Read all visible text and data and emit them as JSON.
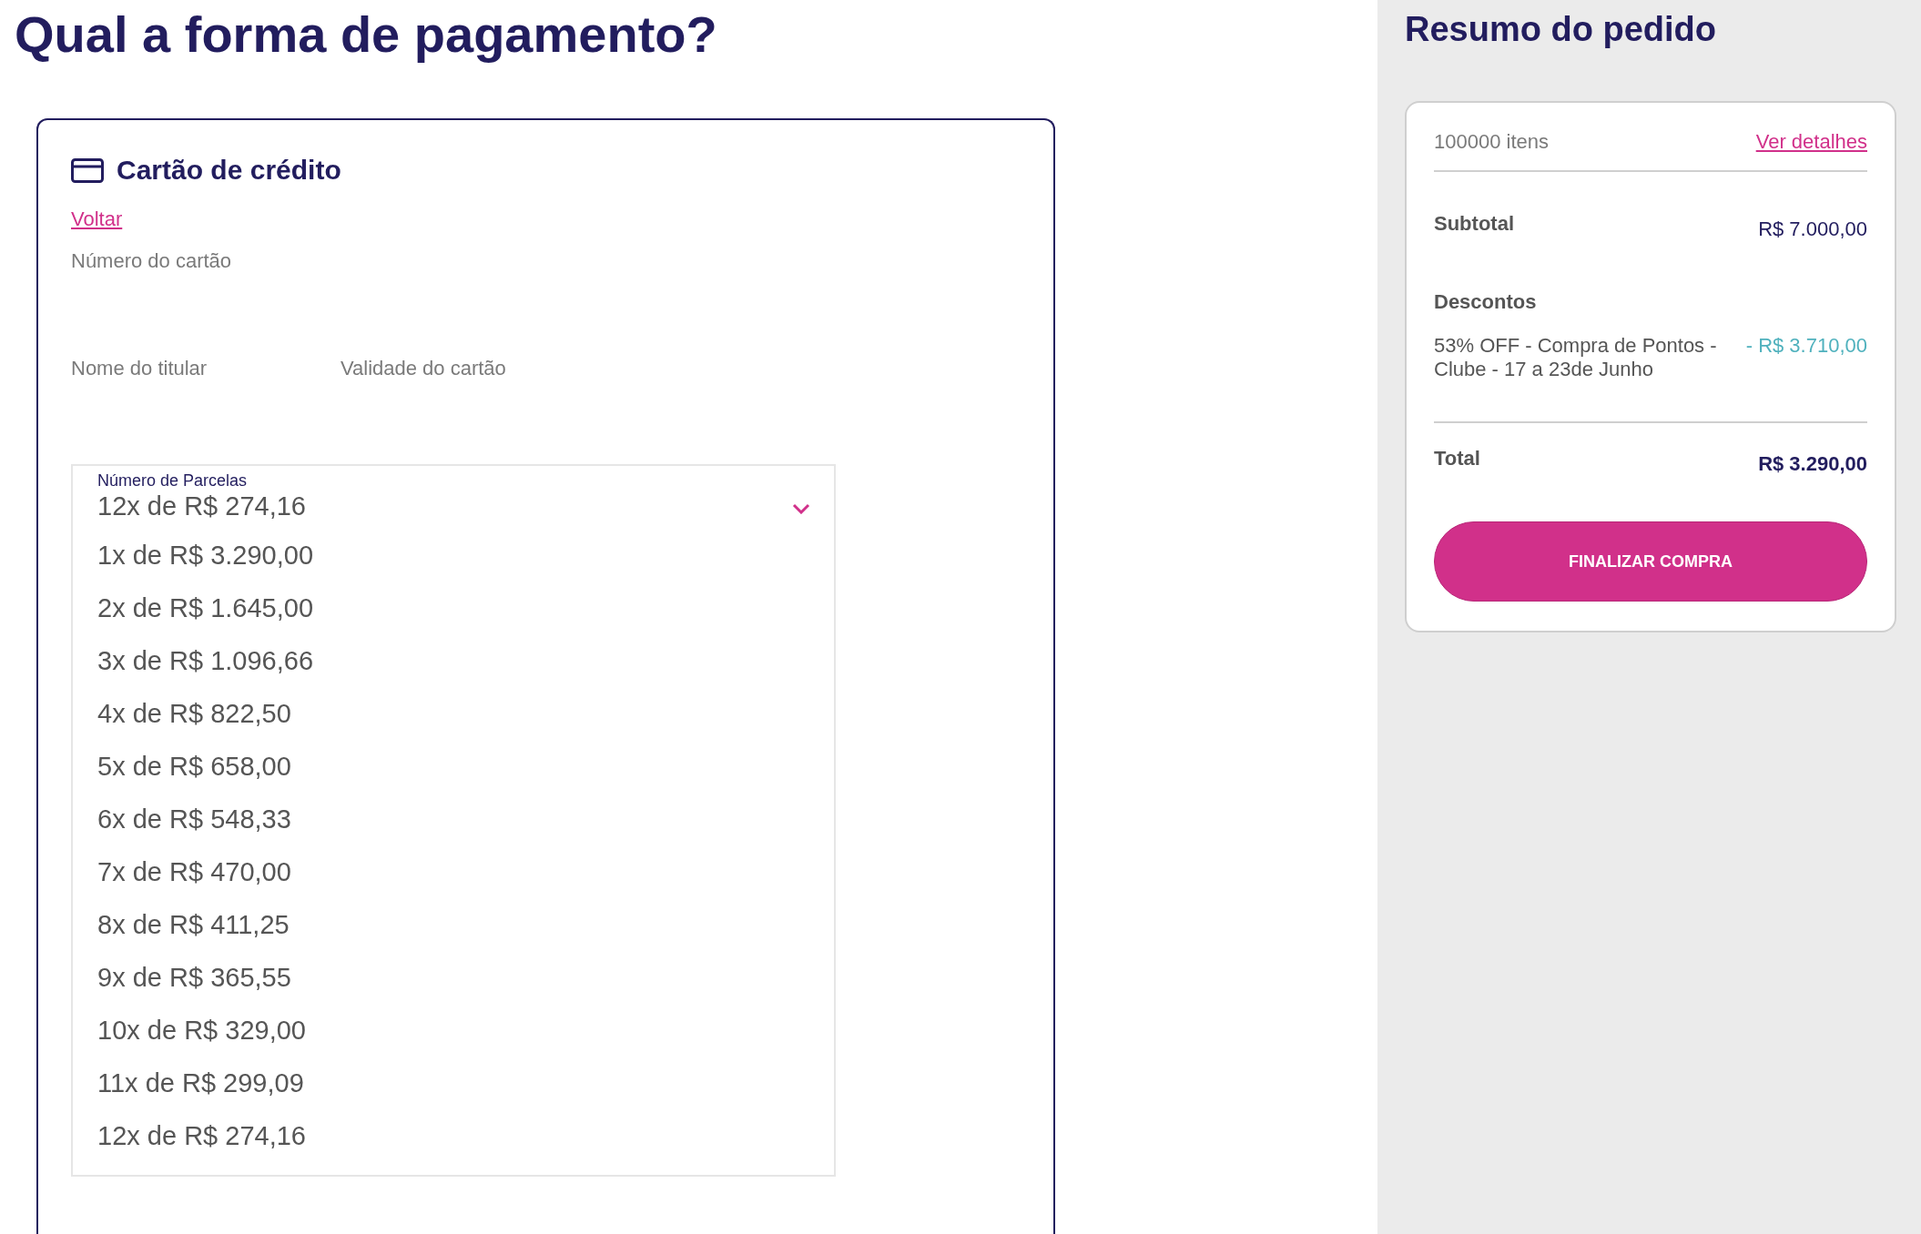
{
  "page_title": "Qual a forma de pagamento?",
  "payment_card": {
    "title": "Cartão de crédito",
    "back_link": "Voltar",
    "fields": [
      {
        "label": "Número do cartão"
      },
      {
        "label": "Nome do titular"
      },
      {
        "label": "Validade do cartão"
      }
    ],
    "installments": {
      "label": "Número de Parcelas",
      "value": "12x de R$ 274,16",
      "expanded": true,
      "options": [
        {
          "label": "1x de R$ 3.290,00"
        },
        {
          "label": "2x de R$ 1.645,00"
        },
        {
          "label": "3x de R$ 1.096,66"
        },
        {
          "label": "4x de R$ 822,50"
        },
        {
          "label": "5x de R$ 658,00"
        },
        {
          "label": "6x de R$ 548,33"
        },
        {
          "label": "7x de R$ 470,00"
        },
        {
          "label": "8x de R$ 411,25"
        },
        {
          "label": "9x de R$ 365,55"
        },
        {
          "label": "10x de R$ 329,00"
        },
        {
          "label": "11x de R$ 299,09"
        },
        {
          "label": "12x de R$ 274,16"
        }
      ]
    }
  },
  "order_summary": {
    "title": "Resumo do pedido",
    "items_count": "100000 itens",
    "details_link": "Ver detalhes",
    "subtotal": {
      "label": "Subtotal",
      "value": "R$ 7.000,00"
    },
    "discounts": {
      "label": "Descontos",
      "items": [
        {
          "description": "53% OFF - Compra de Pontos - Clube - 17 a 23de Junho",
          "value": "- R$ 3.710,00"
        }
      ]
    },
    "total": {
      "label": "Total",
      "value": "R$ 3.290,00"
    },
    "button": "FINALIZAR COMPRA"
  }
}
